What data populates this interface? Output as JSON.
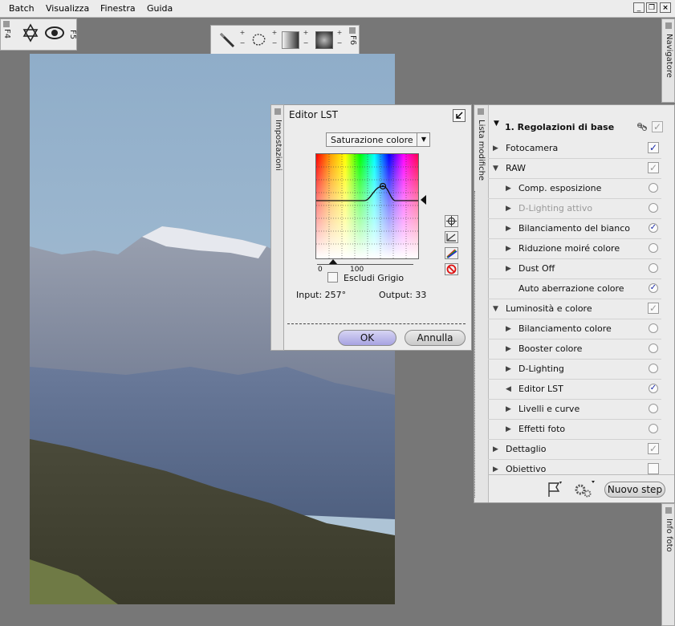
{
  "menubar": {
    "items": [
      "Batch",
      "Visualizza",
      "Finestra",
      "Guida"
    ]
  },
  "palettes": {
    "f4_label": "F4",
    "f5_label": "F5",
    "f6_label": "F6"
  },
  "side_tabs": {
    "navigatore": "Navigatore",
    "impostazioni": "Impostazioni",
    "lista_modifiche": "Lista modifiche",
    "info_foto": "Info foto"
  },
  "editor": {
    "title": "Editor LST",
    "mode_select": "Saturazione colore",
    "scale_min": "0",
    "scale_max": "100",
    "exclude_gray_label": "Escludi Grigio",
    "input_label": "Input: 257°",
    "output_label": "Output: 33",
    "ok_label": "OK",
    "cancel_label": "Annulla"
  },
  "list": {
    "section_title": "1. Regolazioni di base",
    "rows": [
      {
        "label": "Fotocamera",
        "indent": 1,
        "expand": "right",
        "control": "checkbox",
        "checked": true
      },
      {
        "label": "RAW",
        "indent": 1,
        "expand": "down",
        "control": "checkbox",
        "checked": true,
        "dim": true
      },
      {
        "label": "Comp. esposizione",
        "indent": 2,
        "expand": "right",
        "control": "radio",
        "checked": false
      },
      {
        "label": "D-Lighting attivo",
        "indent": 2,
        "expand": "right",
        "control": "radio",
        "checked": false,
        "disabled": true
      },
      {
        "label": "Bilanciamento del bianco",
        "indent": 2,
        "expand": "right",
        "control": "radio",
        "checked": true
      },
      {
        "label": "Riduzione moiré colore",
        "indent": 2,
        "expand": "right",
        "control": "radio",
        "checked": false
      },
      {
        "label": "Dust Off",
        "indent": 2,
        "expand": "right",
        "control": "radio",
        "checked": false
      },
      {
        "label": "Auto aberrazione colore",
        "indent": 2,
        "expand": "none",
        "control": "radio",
        "checked": true
      },
      {
        "label": "Luminosità e colore",
        "indent": 1,
        "expand": "down",
        "control": "checkbox",
        "checked": true,
        "dim": true
      },
      {
        "label": "Bilanciamento colore",
        "indent": 2,
        "expand": "right",
        "control": "radio",
        "checked": false
      },
      {
        "label": "Booster colore",
        "indent": 2,
        "expand": "right",
        "control": "radio",
        "checked": false
      },
      {
        "label": "D-Lighting",
        "indent": 2,
        "expand": "right",
        "control": "radio",
        "checked": false
      },
      {
        "label": "Editor LST",
        "indent": 2,
        "expand": "left",
        "control": "radio",
        "checked": true
      },
      {
        "label": "Livelli e curve",
        "indent": 2,
        "expand": "right",
        "control": "radio",
        "checked": false
      },
      {
        "label": "Effetti foto",
        "indent": 2,
        "expand": "right",
        "control": "radio",
        "checked": false
      },
      {
        "label": "Dettaglio",
        "indent": 1,
        "expand": "right",
        "control": "checkbox",
        "checked": true,
        "dim": true
      },
      {
        "label": "Obiettivo",
        "indent": 1,
        "expand": "right",
        "control": "checkbox",
        "checked": false
      }
    ],
    "new_step_label": "Nuovo step"
  }
}
